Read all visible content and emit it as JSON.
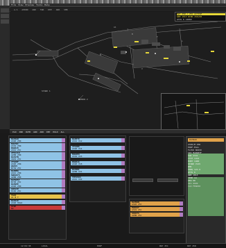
{
  "menubar": {
    "items": [
      "File",
      "View",
      "Preview",
      "Tools",
      "Help"
    ]
  },
  "toolbar": {
    "items": [
      "A-S",
      "APRON",
      "GND",
      "TWR",
      "DEP",
      "ARR",
      "SMR"
    ]
  },
  "info_panel": {
    "rows": [
      "RWY 25R / 25C ACTIVE",
      "QNH 1013 WIND 250/08",
      "ATIS K  1400Z"
    ]
  },
  "map_labels": [
    "A1",
    "B",
    "T",
    "L",
    "N",
    "V",
    "STAND 1",
    "APRON 2"
  ],
  "lower_toolbar": {
    "items": [
      "PLN",
      "INB",
      "OUTB",
      "GND",
      "ARR",
      "DEP",
      "HOLD",
      "ALL"
    ]
  },
  "left_strips": [
    {
      "cs": "DLH4AU",
      "ty": "A320 25R",
      "color": "#8fc3e6"
    },
    {
      "cs": "EWG7KC",
      "ty": "A319 25R",
      "color": "#8fc3e6"
    },
    {
      "cs": "BAW915",
      "ty": "A321 25C",
      "color": "#8fc3e6"
    },
    {
      "cs": "AFR1418",
      "ty": "A20N 25R",
      "color": "#8fc3e6"
    },
    {
      "cs": "DLH1TN",
      "ty": "CRJ9 25C",
      "color": "#8fc3e6"
    },
    {
      "cs": "CFG2KF",
      "ty": "A320 25R",
      "color": "#8fc3e6"
    },
    {
      "cs": "UAE45",
      "ty": "B77W 25C",
      "color": "#8fc3e6"
    },
    {
      "cs": "DLH6MA",
      "ty": "A321 25R",
      "color": "#8fc3e6"
    },
    {
      "cs": "SWR1073",
      "ty": "A20N 25R",
      "color": "#8fc3e6"
    },
    {
      "cs": "KLM1857",
      "ty": "B738 25C",
      "color": "#8fc3e6"
    },
    {
      "cs": "DLH9PE",
      "ty": "A320 25R",
      "color": "#8fc3e6"
    },
    {
      "cs": "AUA14V",
      "ty": "E195 25C",
      "color": "#8fc3e6"
    }
  ],
  "left_special": [
    {
      "cs": "TAXI",
      "ty": "A1 B T",
      "color": "#e6c24a"
    },
    {
      "cs": "DLH2CE",
      "ty": "A320 HOLD",
      "color": "#8fc3e6"
    },
    {
      "cs": "STOP",
      "ty": "N4",
      "color": "#c83a3a"
    }
  ],
  "mid_strips": [
    {
      "cs": "DLH8TX",
      "ty": "A321 V12",
      "color": "#8fc3e6"
    },
    {
      "cs": "CFG1NS",
      "ty": "A320 V14",
      "color": "#8fc3e6"
    },
    {
      "cs": "EWG4PA",
      "ty": "A319 V16",
      "color": "#8fc3e6"
    },
    {
      "cs": "BAW911",
      "ty": "A320 V18",
      "color": "#8fc3e6"
    },
    {
      "cs": "DLH3KL",
      "ty": "A20N V21",
      "color": "#8fc3e6"
    },
    {
      "cs": "THY1594",
      "ty": "A321 V22",
      "color": "#8fc3e6"
    }
  ],
  "orange_strips": [
    {
      "cs": "DLH5UN",
      "ty": "A320 25C",
      "color": "#e0a24a"
    },
    {
      "cs": "EWG9XT",
      "ty": "A319 25C",
      "color": "#e0a24a"
    },
    {
      "cs": "SAS671",
      "ty": "A20N 25C",
      "color": "#e0a24a"
    }
  ],
  "right_panel": {
    "header": "DLH4AU",
    "rows": [
      "A320/M  25R",
      "EDDF-EGLL",
      "FL350  N0450",
      "SID MARUN7F",
      "SQK 2341",
      "CTOT 1412",
      "EOBT 1400",
      "STAND V145",
      "RMK",
      "FREQ 121.9",
      "ATIS K",
      "QNH 1013",
      "TEMP 14",
      "DEW 08",
      "VIS 9999",
      "CLD FEW030"
    ]
  },
  "bottom_status": [
    "12:04:38",
    "LOCAL",
    "EDDF",
    "RWY 25C",
    "RWY 25R"
  ]
}
